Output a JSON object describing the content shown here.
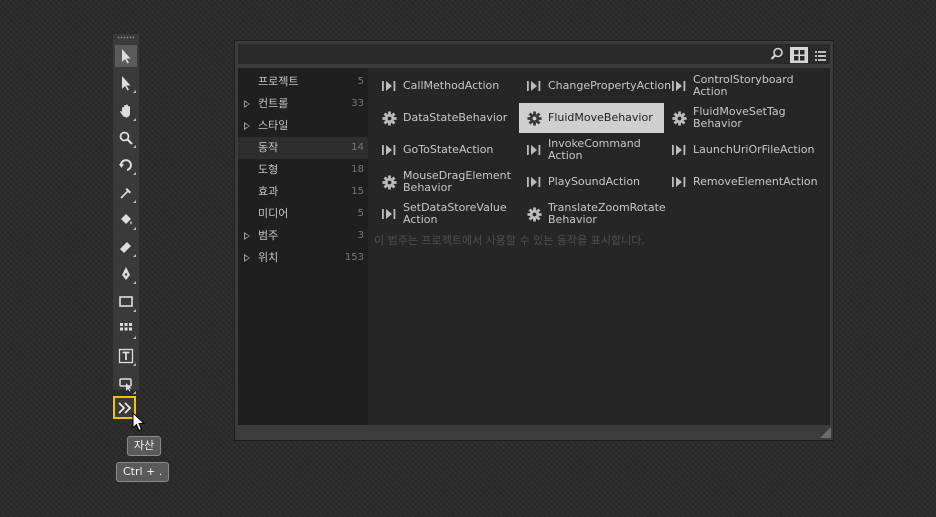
{
  "toolbar": {
    "tools": [
      "selection-icon",
      "direct-selection-icon",
      "pan-icon",
      "zoom-icon",
      "camera-orbit-icon",
      "eyedropper-icon",
      "paint-bucket-icon",
      "gradient-icon",
      "pen-icon",
      "rectangle-icon",
      "grid-layout-icon",
      "text-block-icon",
      "control-icon"
    ],
    "active_tool": "selection-icon",
    "assets_tooltip": "자산",
    "assets_shortcut": "Ctrl + ."
  },
  "assets_panel": {
    "search": {
      "value": "",
      "placeholder": ""
    },
    "view_modes": [
      "grid-view-icon",
      "list-view-icon"
    ],
    "active_view": "grid-view-icon",
    "categories": [
      {
        "label": "프로젝트",
        "count": "5",
        "expandable": false,
        "selected": false
      },
      {
        "label": "컨트롤",
        "count": "33",
        "expandable": true,
        "selected": false
      },
      {
        "label": "스타일",
        "count": "",
        "expandable": true,
        "selected": false
      },
      {
        "label": "동작",
        "count": "14",
        "expandable": false,
        "selected": true
      },
      {
        "label": "도형",
        "count": "18",
        "expandable": false,
        "selected": false
      },
      {
        "label": "효과",
        "count": "15",
        "expandable": false,
        "selected": false
      },
      {
        "label": "미디어",
        "count": "5",
        "expandable": false,
        "selected": false
      },
      {
        "label": "범주",
        "count": "3",
        "expandable": true,
        "selected": false
      },
      {
        "label": "위치",
        "count": "153",
        "expandable": true,
        "selected": false
      }
    ],
    "items": [
      {
        "name": "CallMethodAction",
        "icon": "action-icon"
      },
      {
        "name": "ChangePropertyAction",
        "icon": "action-icon"
      },
      {
        "name": "ControlStoryboard\nAction",
        "icon": "action-icon"
      },
      {
        "name": "DataStateBehavior",
        "icon": "behavior-gear-icon"
      },
      {
        "name": "FluidMoveBehavior",
        "icon": "behavior-gear-icon",
        "selected": true
      },
      {
        "name": "FluidMoveSetTag\nBehavior",
        "icon": "behavior-gear-icon"
      },
      {
        "name": "GoToStateAction",
        "icon": "action-icon"
      },
      {
        "name": "InvokeCommand\nAction",
        "icon": "action-icon"
      },
      {
        "name": "LaunchUriOrFileAction",
        "icon": "action-icon"
      },
      {
        "name": "MouseDragElement\nBehavior",
        "icon": "behavior-gear-icon"
      },
      {
        "name": "PlaySoundAction",
        "icon": "action-icon"
      },
      {
        "name": "RemoveElementAction",
        "icon": "action-icon"
      },
      {
        "name": "SetDataStoreValue\nAction",
        "icon": "action-icon"
      },
      {
        "name": "TranslateZoomRotate\nBehavior",
        "icon": "behavior-gear-icon"
      }
    ],
    "description": "이 범주는 프로젝트에서 사용할 수 있는 동작을 표시합니다."
  },
  "colors": {
    "highlight_border": "#f2c200",
    "selected_item": "#cfcfcf",
    "panel_bg": "#262626"
  }
}
